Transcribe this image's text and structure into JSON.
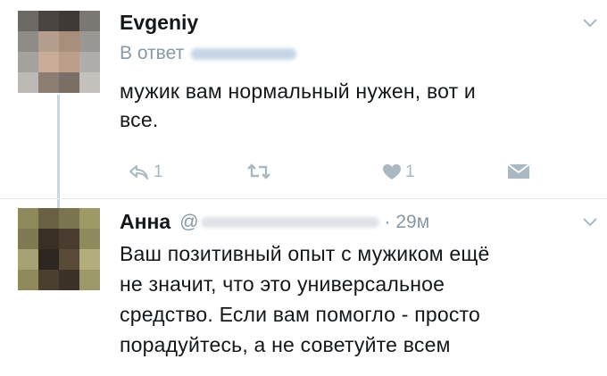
{
  "tweets": [
    {
      "author_name": "Evgeniy",
      "reply_prefix": "В ответ",
      "text_lines": [
        "мужик вам нормальный нужен, вот и",
        "все."
      ],
      "actions": {
        "reply_count": "1",
        "like_count": "1"
      },
      "icons": [
        "reply-icon",
        "retweet-icon",
        "like-icon",
        "direct-message-icon",
        "chevron-down-icon"
      ]
    },
    {
      "author_name": "Анна",
      "handle_prefix": "@",
      "timestamp": "· 29м",
      "text_lines": [
        "Ваш позитивный опыт с мужиком ещё",
        "не значит, что это универсальное",
        "средство. Если вам помогло - просто",
        "порадуйтесь, а не советуйте всем"
      ],
      "icons": [
        "chevron-down-icon"
      ]
    }
  ],
  "colors": {
    "text": "#14171a",
    "muted": "#8899a6",
    "icon": "#aab8c2",
    "divider": "#e6ecf0",
    "thread_line": "#ccd6dd"
  }
}
